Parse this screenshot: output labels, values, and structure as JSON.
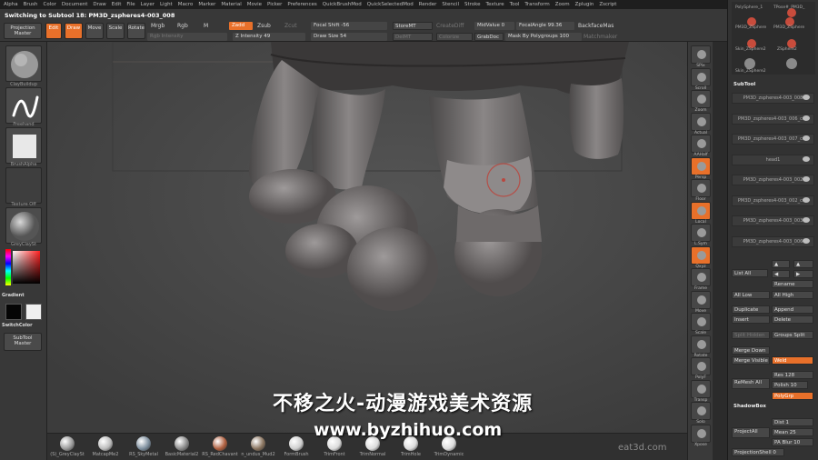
{
  "menubar": {
    "items": [
      "Alpha",
      "Brush",
      "Color",
      "Document",
      "Draw",
      "Edit",
      "File",
      "Layer",
      "Light",
      "Macro",
      "Marker",
      "Material",
      "Movie",
      "Picker",
      "Preferences",
      "QuickBrushMod",
      "QuickSelectedMod",
      "Render",
      "Stencil",
      "Stroke",
      "Texture",
      "Tool",
      "Transform",
      "Zoom",
      "Zplugin",
      "Zscript"
    ]
  },
  "toolbar": {
    "switch_label": "Switching to Subtool 18:",
    "switch_value": "PM3D_zspheres4-003_008",
    "projection_master": "Projection Master",
    "edit": "Edit",
    "draw": "Draw",
    "move": "Move",
    "scale": "Scale",
    "rotate": "Rotate",
    "mrgb": "Mrgb",
    "rgb": "Rgb",
    "m": "M",
    "zadd": "Zadd",
    "zsub": "Zsub",
    "zcut": "Zcut",
    "rgb_intensity": "Rgb Intensity",
    "z_intensity": "Z Intensity 49",
    "focal_shift": "Focal Shift -56",
    "draw_size": "Draw Size 54",
    "store_mt": "StoreMT",
    "del_mt": "DelMT",
    "create_diff": "CreateDiff",
    "grab_doc": "GrabDoc",
    "mid_value": "MidValue 0",
    "focal_angle": "FocalAngle 99.36",
    "backface_mask": "BackfaceMas",
    "mask_by_polygroups": "Mask By Polygroups 100",
    "colorize": "Colorize",
    "matchmaker": "Matchmaker"
  },
  "leftshelf": {
    "brush_label": "ClayBuildup",
    "stroke_label": "Freehand",
    "alpha_label": "BrushAlpha",
    "texture_label": "Texture Off",
    "material_label": "GreyClaySt",
    "gradient_label": "Gradient",
    "switchcolor_label": "SwitchColor",
    "subtool_master": "SubTool Master"
  },
  "rightshelf": {
    "items": [
      "SPix",
      "Scroll",
      "Zoom",
      "Actual",
      "AAHalf",
      "Persp",
      "Floor",
      "Local",
      "L.Sym",
      "Qxyz",
      "Frame",
      "Move",
      "Scale",
      "Rotate",
      "PolyF",
      "Transp",
      "Solo",
      "Xpose"
    ]
  },
  "rightpanel": {
    "tool_thumbs": [
      "PolySphere_1",
      "TPose#_PM3D_",
      "PM3D_ZSphere",
      "PM3D_ZSphere",
      "Skin_ZSphere2",
      "ZSphere2",
      "Skin_ZSphere2"
    ],
    "subtool_header": "SubTool",
    "subtools": [
      "PM3D_zspheres4-003_008",
      "PM3D_zspheres4-003_006_cop",
      "PM3D_zspheres4-003_007_cop",
      "head1",
      "PM3D_zspheres4-003_002",
      "PM3D_zspheres4-003_002_cop",
      "PM3D_zspheres4-003_003",
      "PM3D_zspheres4-003_006"
    ],
    "list_all": "List All",
    "rename": "Rename",
    "all_low": "All Low",
    "all_high": "All High",
    "duplicate": "Duplicate",
    "append": "Append",
    "insert": "Insert",
    "delete": "Delete",
    "split_hidden": "Split Hidden",
    "groups_split": "Groups Split",
    "merge_down": "Merge Down",
    "merge_visible": "Merge Visible",
    "weld": "Weld",
    "remesh_all": "ReMesh All",
    "res": "Res 128",
    "polish": "Polish 10",
    "polygrp": "PolyGrp",
    "shadowbox": "ShadowBox",
    "project_all": "ProjectAll",
    "dist": "Dist 1",
    "mean": "Mean 25",
    "pa_blur": "PA Blur 10",
    "projection_shell": "ProjectionShell 0"
  },
  "bottomshelf": {
    "materials": [
      {
        "label": "(S)_GreyClaySt",
        "color": "#9a9a9a"
      },
      {
        "label": "MatcapMe2",
        "color": "#bcbcbc"
      },
      {
        "label": "RS_SkyMetal",
        "color": "#7e8f9e"
      },
      {
        "label": "BasicMaterial2",
        "color": "#8a8a8a"
      },
      {
        "label": "RS_RedChavant",
        "color": "#b06040"
      },
      {
        "label": "n_undus_Mud2",
        "color": "#8a7560"
      },
      {
        "label": "FormBrush",
        "color": "#cfcfcf"
      },
      {
        "label": "TrimFront",
        "color": "#dcdcdc"
      },
      {
        "label": "TrimNormal",
        "color": "#dcdcdc"
      },
      {
        "label": "TrimHole",
        "color": "#dcdcdc"
      },
      {
        "label": "TrimDynamic",
        "color": "#dcdcdc"
      }
    ]
  },
  "overlay": {
    "watermark_cn": "不移之火-动漫游戏美术资源",
    "watermark_url": "www.byzhihuo.com",
    "eat3d": "eat3d.com"
  },
  "colors": {
    "accent": "#e8702a",
    "panel": "#383838",
    "canvas": "#4a4a4a"
  }
}
